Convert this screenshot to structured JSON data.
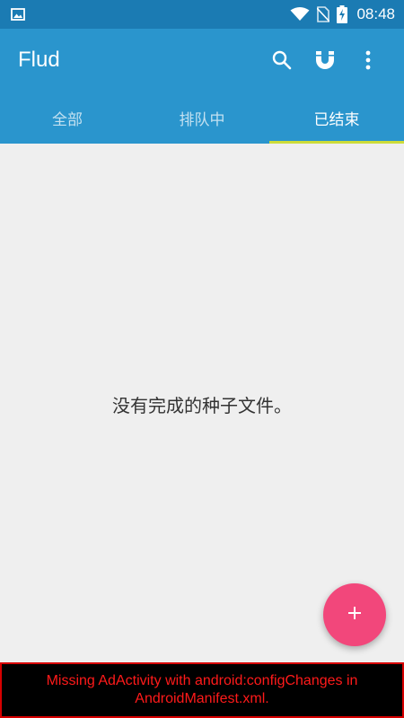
{
  "status_bar": {
    "time": "08:48",
    "icons": [
      "image-notification-icon",
      "wifi-icon",
      "no-sim-icon",
      "battery-charging-icon"
    ]
  },
  "app_bar": {
    "title": "Flud",
    "actions": [
      "search-icon",
      "magnet-icon",
      "more-vert-icon"
    ]
  },
  "tabs": [
    {
      "label": "全部",
      "active": false
    },
    {
      "label": "排队中",
      "active": false
    },
    {
      "label": "已结束",
      "active": true
    }
  ],
  "empty_state": {
    "message": "没有完成的种子文件。"
  },
  "fab": {
    "icon": "plus-icon",
    "color": "#f2477b"
  },
  "error_banner": {
    "line1": "Missing AdActivity with android:configChanges in",
    "line2": "AndroidManifest.xml."
  },
  "colors": {
    "status_bar": "#1b7bb3",
    "app_bar": "#2a95cd",
    "tab_indicator": "#cddc39",
    "background": "#efefef",
    "error_text": "#ff1a1a"
  }
}
